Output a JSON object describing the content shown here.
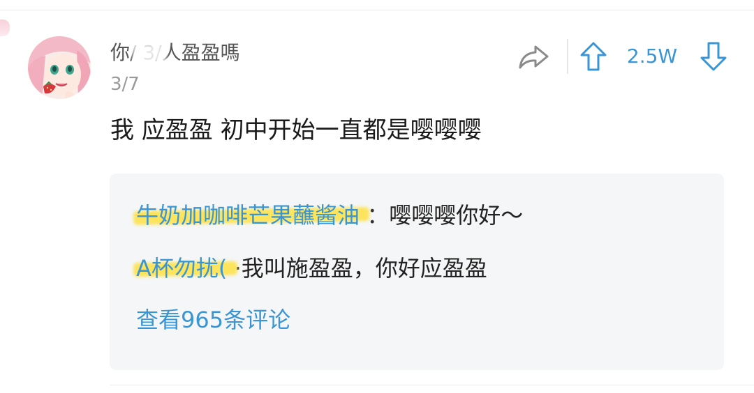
{
  "comment": {
    "username": "你/ 3/人盈盈嗎",
    "date": "3/7",
    "text": "我 应盈盈 初中开始一直都是嘤嘤嘤",
    "vote_count": "2.5W"
  },
  "replies": [
    {
      "name": "牛奶加咖啡芒果蘸酱油",
      "separator": "：",
      "text": "嘤嘤嘤你好～"
    },
    {
      "name": "A杯勿扰(",
      "separator": "·",
      "text": "我叫施盈盈，你好应盈盈"
    }
  ],
  "view_more_label": "查看965条评论",
  "icons": {
    "share": "share-icon",
    "upvote": "arrow-up-icon",
    "downvote": "arrow-down-icon"
  },
  "colors": {
    "accent": "#3a95d5",
    "secondary_text": "#9a9a9a",
    "reply_background": "#f5f6f7",
    "highlight": "#ffdd28"
  }
}
